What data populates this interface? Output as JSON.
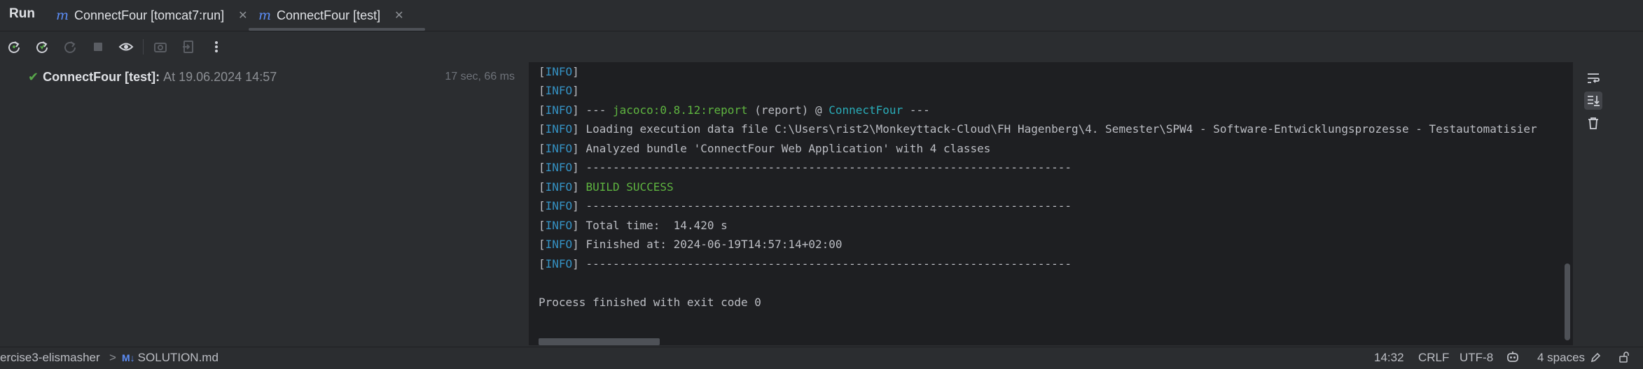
{
  "tool_window": {
    "title": "Run"
  },
  "tabs": [
    {
      "label": "ConnectFour [tomcat7:run]",
      "icon": "maven-icon",
      "active": false
    },
    {
      "label": "ConnectFour [test]",
      "icon": "maven-icon",
      "active": true
    }
  ],
  "toolbar": {
    "icons": [
      "rerun-icon",
      "rerun-failed-icon",
      "rerun-debug-icon",
      "stop-icon",
      "eye-icon",
      "camera-icon",
      "export-icon",
      "more-icon"
    ]
  },
  "tree": {
    "status": "passed",
    "name": "ConnectFour [test]:",
    "time": "At 19.06.2024 14:57",
    "duration": "17 sec, 66 ms"
  },
  "console": {
    "info_tag": "INFO",
    "lines": {
      "l0": "",
      "l1": "",
      "l2_pre": " --- ",
      "l2_plugin": "jacoco:0.8.12:report",
      "l2_mid": " (report) @ ",
      "l2_project": "ConnectFour",
      "l2_post": " ---",
      "l3": " Loading execution data file C:\\Users\\rist2\\Monkeyttack-Cloud\\FH Hagenberg\\4. Semester\\SPW4 - Software-Entwicklungsprozesse - Testautomatisier",
      "l4": " Analyzed bundle 'ConnectFour Web Application' with 4 classes",
      "l5": " ------------------------------------------------------------------------",
      "l6": "BUILD SUCCESS",
      "l7": " ------------------------------------------------------------------------",
      "l8": " Total time:  14.420 s",
      "l9": " Finished at: 2024-06-19T14:57:14+02:00",
      "l10": " ------------------------------------------------------------------------"
    },
    "exit_line": "Process finished with exit code 0"
  },
  "side_tools": [
    "soft-wrap-icon",
    "scroll-to-end-icon",
    "trash-icon"
  ],
  "statusbar": {
    "breadcrumb_project": "ercise3-elismasher",
    "breadcrumb_sep": ">",
    "file_badge": "M↓",
    "file_name": "SOLUTION.md",
    "cursor": "14:32",
    "line_sep": "CRLF",
    "encoding": "UTF-8",
    "indent": "4 spaces"
  },
  "colors": {
    "info_blue": "#3592c4",
    "success_green": "#5fb540",
    "teal": "#2aacb8",
    "console_bg": "#1e1f22",
    "panel_bg": "#2b2d30"
  }
}
